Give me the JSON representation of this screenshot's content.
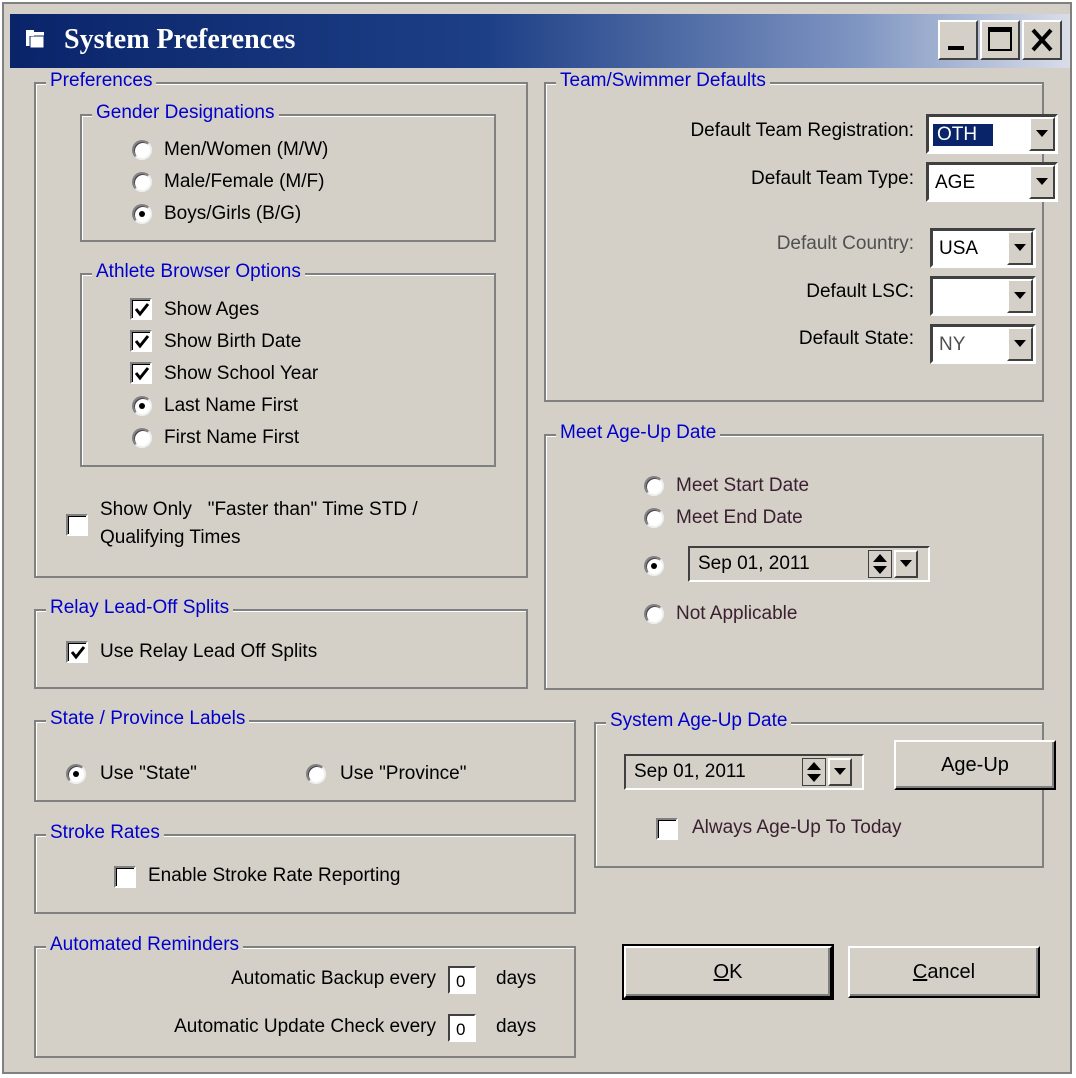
{
  "window": {
    "title": "System Preferences"
  },
  "preferences": {
    "legend": "Preferences",
    "gender": {
      "legend": "Gender Designations",
      "options": [
        "Men/Women (M/W)",
        "Male/Female (M/F)",
        "Boys/Girls (B/G)"
      ],
      "selected": 2
    },
    "athlete_browser": {
      "legend": "Athlete Browser Options",
      "checks": [
        {
          "label": "Show Ages",
          "checked": true
        },
        {
          "label": "Show Birth Date",
          "checked": true
        },
        {
          "label": "Show School Year",
          "checked": true
        }
      ],
      "radios": [
        "Last Name First",
        "First Name First"
      ],
      "selected": 0
    },
    "faster_than": {
      "line1": "Show Only   \"Faster than\" Time STD /",
      "line2": "Qualifying Times",
      "checked": false
    }
  },
  "relay": {
    "legend": "Relay Lead-Off Splits",
    "label": "Use Relay Lead Off Splits",
    "checked": true
  },
  "state_labels": {
    "legend": "State / Province Labels",
    "options": [
      "Use \"State\"",
      "Use \"Province\""
    ],
    "selected": 0
  },
  "stroke_rates": {
    "legend": "Stroke Rates",
    "label": "Enable Stroke Rate Reporting",
    "checked": false
  },
  "reminders": {
    "legend": "Automated Reminders",
    "backup_label": "Automatic Backup every",
    "backup_value": "0",
    "update_label": "Automatic Update Check every",
    "update_value": "0",
    "unit": "days"
  },
  "team_defaults": {
    "legend": "Team/Swimmer Defaults",
    "registration_label": "Default Team Registration:",
    "registration_value": "OTH",
    "type_label": "Default Team Type:",
    "type_value": "AGE",
    "country_label": "Default Country:",
    "country_value": "USA",
    "lsc_label": "Default LSC:",
    "lsc_value": "",
    "state_label": "Default State:",
    "state_value": "NY"
  },
  "meet_ageup": {
    "legend": "Meet Age-Up Date",
    "opt_start": "Meet Start Date",
    "opt_end": "Meet End Date",
    "date_value": "Sep 01, 2011",
    "opt_na": "Not Applicable",
    "selected": 2
  },
  "system_ageup": {
    "legend": "System Age-Up Date",
    "date_value": "Sep 01, 2011",
    "button_label": "Age-Up",
    "always_label": "Always Age-Up To Today",
    "always_checked": false
  },
  "buttons": {
    "ok_mnemonic": "O",
    "ok_rest": "K",
    "cancel_mnemonic": "C",
    "cancel_rest": "ancel"
  },
  "colors": {
    "title_bar_start": "#0a246a",
    "legend_text": "#0000cc",
    "face": "#d4d0c8"
  }
}
